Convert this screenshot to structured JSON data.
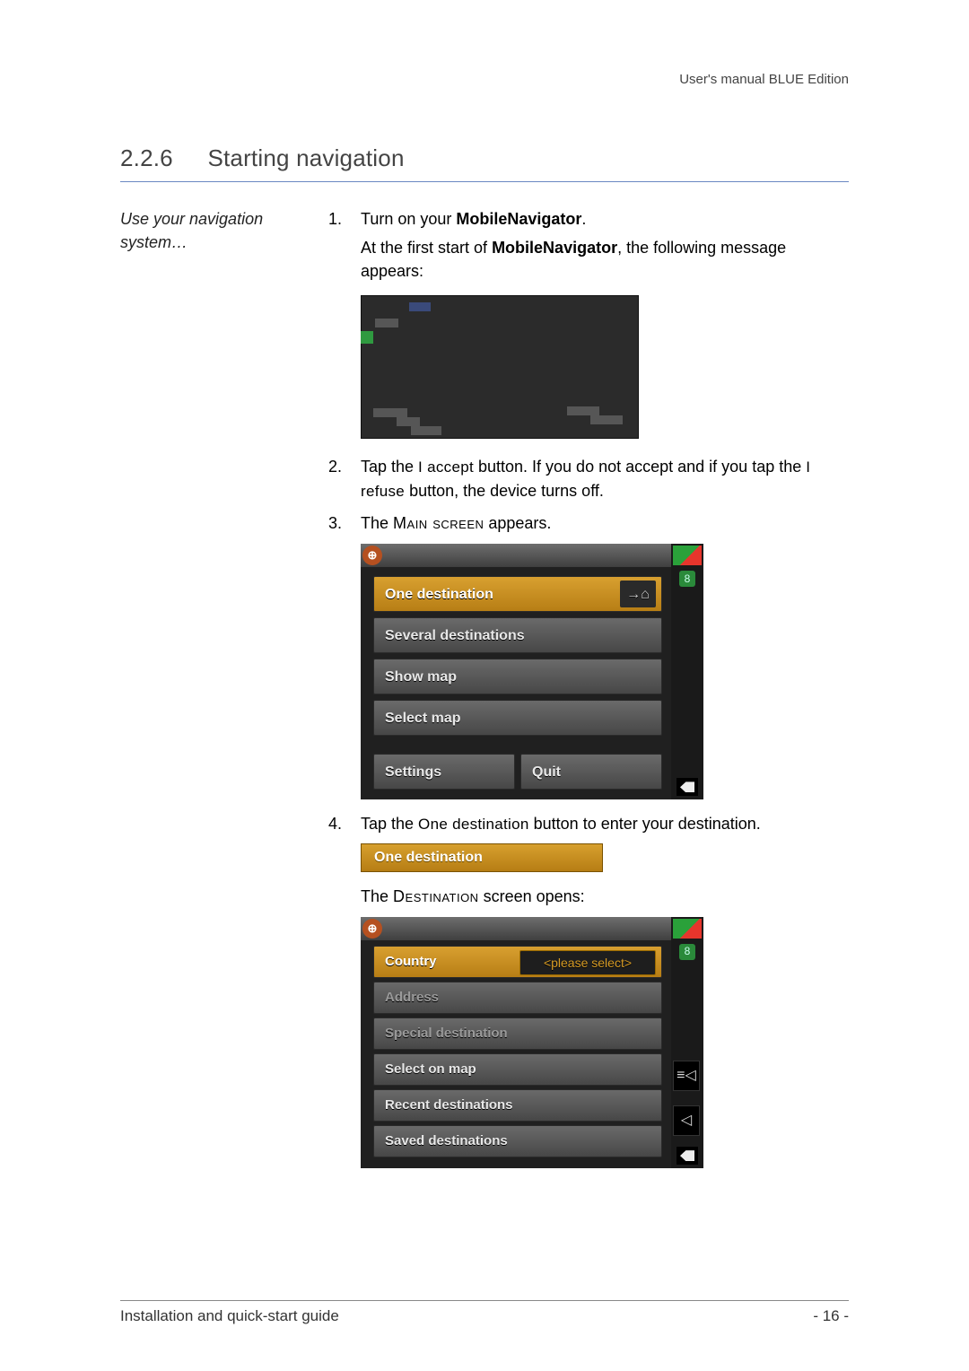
{
  "doc": {
    "header_right": "User's manual BLUE Edition",
    "section_number": "2.2.6",
    "section_title": "Starting navigation",
    "side_note": "Use your navigation system…",
    "footer_left": "Installation and quick-start guide",
    "footer_right": "- 16 -"
  },
  "steps": {
    "s1": {
      "num": "1.",
      "lead": "Turn on your ",
      "bold": "MobileNavigator",
      "trail": ".",
      "sub_a": "At the first start of ",
      "sub_bold": "MobileNavigator",
      "sub_b": ", the following message appears:"
    },
    "s2": {
      "num": "2.",
      "a": "Tap the ",
      "btn1": "I accept",
      "b": " button. If you do not accept and if you tap the ",
      "btn2": "I refuse",
      "c": " button, the device turns off."
    },
    "s3": {
      "num": "3.",
      "a": "The ",
      "caps": "Main screen",
      "b": " appears."
    },
    "s4": {
      "num": "4.",
      "a": "Tap the ",
      "btn": "One destination",
      "b": " button to enter your destination.",
      "sub_a": "The ",
      "sub_caps": "Destination",
      "sub_b": " screen opens:"
    }
  },
  "main_screen": {
    "satellites": "8",
    "items": {
      "one_destination": "One destination",
      "home_icon_label": "→⌂",
      "several_destinations": "Several destinations",
      "show_map": "Show map",
      "select_map": "Select map",
      "settings": "Settings",
      "quit": "Quit"
    }
  },
  "pill_label": "One destination",
  "dest_screen": {
    "satellites": "8",
    "country": "Country",
    "country_value": "<please select>",
    "address": "Address",
    "special": "Special destination",
    "select_on_map": "Select on map",
    "recent": "Recent destinations",
    "saved": "Saved destinations",
    "side_list_icon": "≡◁",
    "side_back_icon": "◁"
  }
}
